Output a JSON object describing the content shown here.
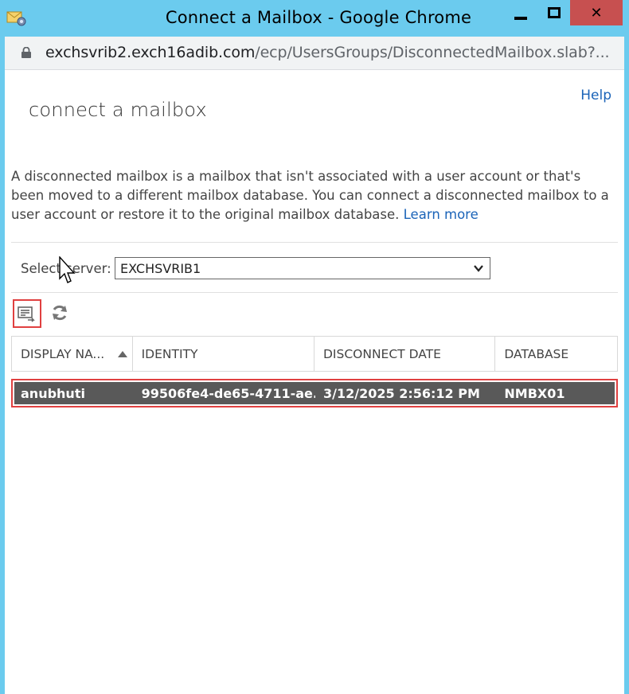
{
  "window": {
    "title": "Connect a Mailbox - Google Chrome",
    "close_glyph": "✕"
  },
  "address_bar": {
    "host": "exchsvrib2.exch16adib.com",
    "path": "/ecp/UsersGroups/DisconnectedMailbox.slab?..."
  },
  "page": {
    "title": "connect a mailbox",
    "help_label": "Help",
    "description": "A disconnected mailbox is a mailbox that isn't associated with a user account or that's been moved to a different mailbox database. You can connect a disconnected mailbox to a user account or restore it to the original mailbox database.",
    "learn_more_label": "Learn more"
  },
  "server_selector": {
    "label": "Select server:",
    "selected": "EXCHSVRIB1"
  },
  "toolbar": {
    "icons": [
      "connect-mailbox-icon",
      "refresh-icon"
    ]
  },
  "table": {
    "columns": [
      "DISPLAY NA...",
      "IDENTITY",
      "DISCONNECT DATE",
      "DATABASE"
    ],
    "sort_column": 0,
    "rows": [
      {
        "display_name": "anubhuti",
        "identity": "99506fe4-de65-4711-ae...",
        "disconnect_date": "3/12/2025 2:56:12 PM",
        "database": "NMBX01",
        "selected": true
      }
    ]
  },
  "colors": {
    "chrome_frame": "#6bcbee",
    "close_button": "#c75050",
    "link": "#1a63b8",
    "selected_row": "#595959",
    "highlight_box": "#e04040"
  }
}
